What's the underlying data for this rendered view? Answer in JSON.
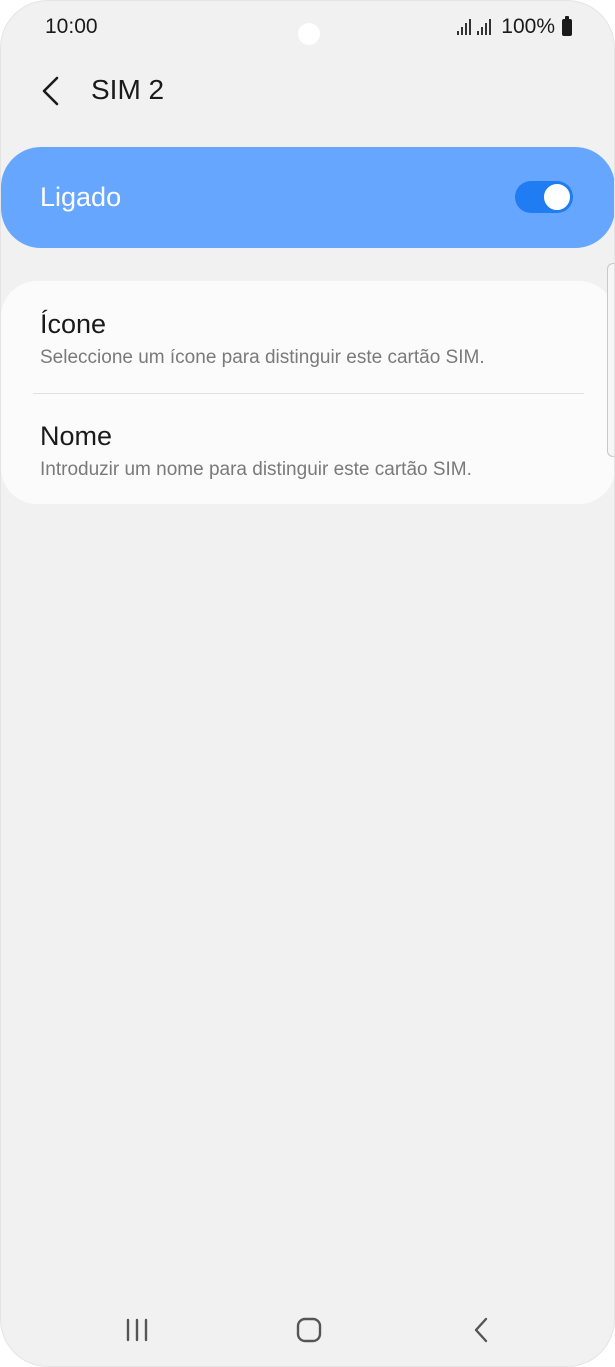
{
  "status_bar": {
    "time": "10:00",
    "battery": "100%"
  },
  "header": {
    "title": "SIM 2"
  },
  "master_switch": {
    "label": "Ligado",
    "state": "on"
  },
  "settings": [
    {
      "title": "Ícone",
      "description": "Seleccione um ícone para distinguir este cartão SIM."
    },
    {
      "title": "Nome",
      "description": "Introduzir um nome para distinguir este cartão SIM."
    }
  ],
  "colors": {
    "accent": "#1f7cf2",
    "master_bg": "#67a6ff",
    "background": "#f1f1f1",
    "card": "#fbfbfb"
  },
  "icons": {
    "back": "back-arrow-icon",
    "recent": "recent-apps-icon",
    "home": "home-icon",
    "nav_back": "nav-back-icon"
  }
}
